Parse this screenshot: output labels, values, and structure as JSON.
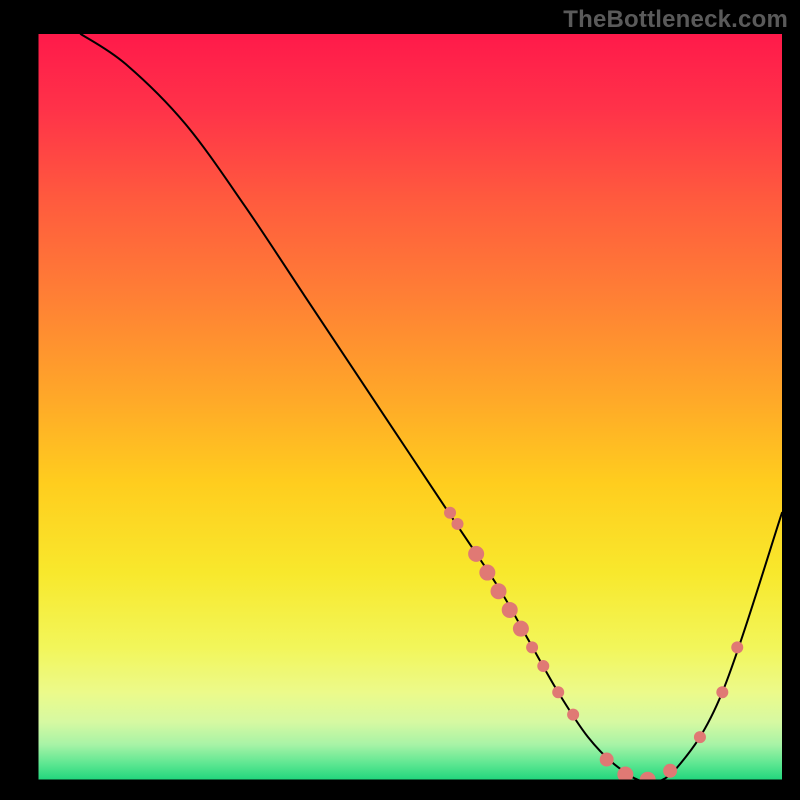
{
  "watermark": "TheBottleneck.com",
  "chart_data": {
    "type": "line",
    "title": "",
    "xlabel": "",
    "ylabel": "",
    "xlim": [
      0,
      100
    ],
    "ylim": [
      0,
      100
    ],
    "grid": false,
    "series": [
      {
        "name": "curve",
        "x": [
          6,
          12,
          20,
          28,
          36,
          44,
          50,
          56,
          62,
          66,
          70,
          74,
          78,
          82,
          86,
          92,
          100
        ],
        "y": [
          100,
          96,
          88,
          77,
          65,
          53,
          44,
          35,
          26,
          19,
          12,
          6,
          2,
          0,
          2,
          12,
          36
        ],
        "stroke": "#000000",
        "stroke_width": 2
      }
    ],
    "markers": [
      {
        "x": 55.5,
        "y": 36.0,
        "r": 6
      },
      {
        "x": 56.5,
        "y": 34.5,
        "r": 6
      },
      {
        "x": 59.0,
        "y": 30.5,
        "r": 8
      },
      {
        "x": 60.5,
        "y": 28.0,
        "r": 8
      },
      {
        "x": 62.0,
        "y": 25.5,
        "r": 8
      },
      {
        "x": 63.5,
        "y": 23.0,
        "r": 8
      },
      {
        "x": 65.0,
        "y": 20.5,
        "r": 8
      },
      {
        "x": 66.5,
        "y": 18.0,
        "r": 6
      },
      {
        "x": 68.0,
        "y": 15.5,
        "r": 6
      },
      {
        "x": 70.0,
        "y": 12.0,
        "r": 6
      },
      {
        "x": 72.0,
        "y": 9.0,
        "r": 6
      },
      {
        "x": 76.5,
        "y": 3.0,
        "r": 7
      },
      {
        "x": 79.0,
        "y": 1.0,
        "r": 8
      },
      {
        "x": 82.0,
        "y": 0.3,
        "r": 8
      },
      {
        "x": 85.0,
        "y": 1.5,
        "r": 7
      },
      {
        "x": 89.0,
        "y": 6.0,
        "r": 6
      },
      {
        "x": 92.0,
        "y": 12.0,
        "r": 6
      },
      {
        "x": 94.0,
        "y": 18.0,
        "r": 6
      }
    ],
    "marker_color": "#e07974",
    "background": {
      "type": "vertical-gradient",
      "stops": [
        {
          "offset": 0.0,
          "color": "#ff1a4a"
        },
        {
          "offset": 0.1,
          "color": "#ff3249"
        },
        {
          "offset": 0.22,
          "color": "#ff5a3e"
        },
        {
          "offset": 0.35,
          "color": "#ff7f35"
        },
        {
          "offset": 0.48,
          "color": "#ffa629"
        },
        {
          "offset": 0.6,
          "color": "#ffcd1e"
        },
        {
          "offset": 0.72,
          "color": "#f8e82c"
        },
        {
          "offset": 0.82,
          "color": "#f2f65a"
        },
        {
          "offset": 0.88,
          "color": "#ecfa8a"
        },
        {
          "offset": 0.92,
          "color": "#d6f9a2"
        },
        {
          "offset": 0.95,
          "color": "#a7f3a6"
        },
        {
          "offset": 0.975,
          "color": "#5fe792"
        },
        {
          "offset": 1.0,
          "color": "#19d47a"
        }
      ]
    }
  }
}
